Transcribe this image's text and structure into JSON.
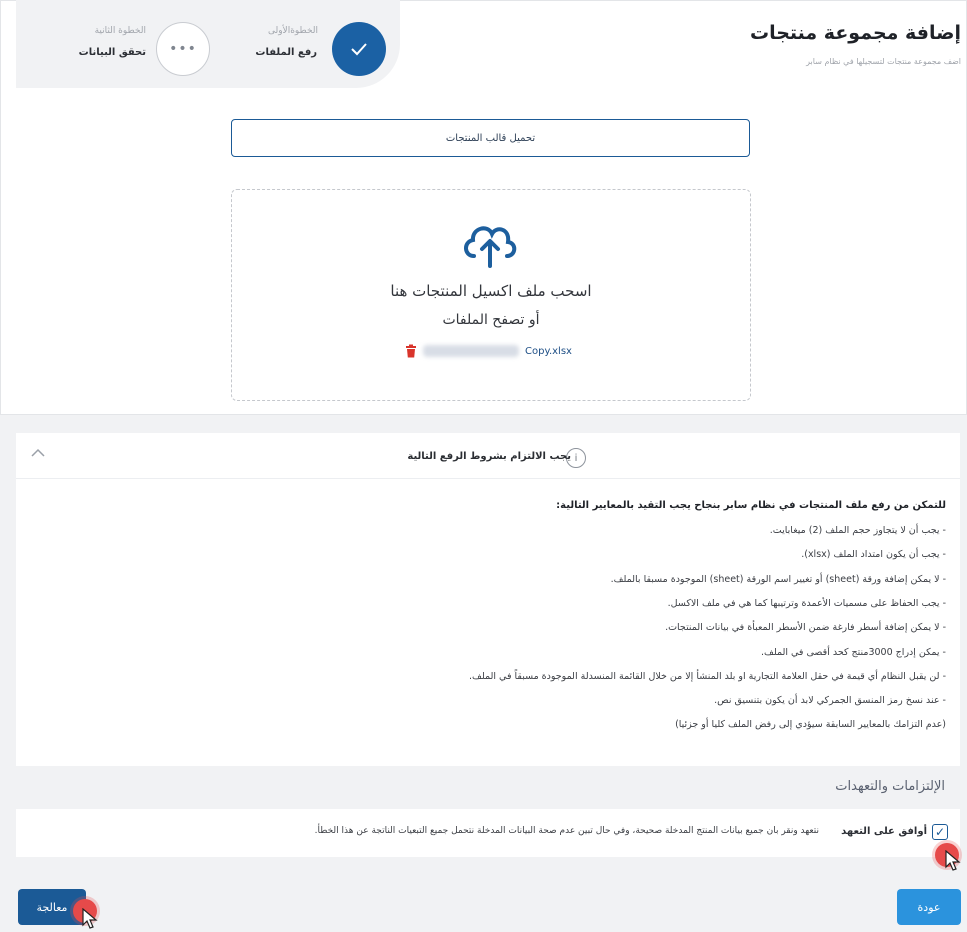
{
  "header": {
    "title": "إضافة مجموعة منتجات",
    "subtitle": "اضف مجموعة منتجات لتسجيلها في نظام سابر"
  },
  "stepper": {
    "step1": {
      "label": "الخطوةالأولى",
      "title": "رفع الملفات",
      "status": "done"
    },
    "step2": {
      "label": "الخطوة الثانية",
      "title": "تحقق البيانات",
      "status": "pending",
      "glyph": "•••"
    }
  },
  "upload": {
    "template_button": "تحميل قالب المنتجات",
    "drop_title": "اسحب ملف اكسيل المنتجات هنا",
    "browse": "أو تصفح الملفات",
    "file_name": "Copy.xlsx"
  },
  "rules": {
    "title": "يجب الالتزام بشروط الرفع التالية",
    "intro": "للتمكن من رفع ملف المنتجات في نظام سابر بنجاح يجب التقيد بالمعايير التالية:",
    "items": [
      "- يجب أن لا يتجاوز حجم الملف (2) ميغابايت.",
      "- يجب أن يكون امتداد الملف (xlsx).",
      "- لا يمكن إضافة ورقة (sheet) أو تغيير اسم الورقة (sheet) الموجودة مسبقا بالملف.",
      "- يجب الحفاظ على مسميات الأعمدة وترتيبها كما هي في ملف الاكسل.",
      "- لا يمكن إضافة أسطر فارغة ضمن الأسطر المعبأة في بيانات المنتجات.",
      "- يمكن إدراج 3000منتج كحد أقصى في الملف.",
      "- لن يقبل النظام أي قيمة في حقل العلامة التجارية او بلد المنشأ إلا من خلال القائمة المنسدلة الموجودة مسبقاً في الملف.",
      "- عند نسخ رمز المنسق الجمركي لابد أن يكون بتنسيق نص.",
      "(عدم التزامك بالمعايير السابقة سيؤدي إلى رفض الملف كليا أو جزئيا)"
    ]
  },
  "commitments": {
    "heading": "الإلتزامات والتعهدات",
    "agree_label": "أوافق على التعهد",
    "text": "نتعهد ونقر بان جميع بيانات المنتج المدخلة صحيحة، وفي حال تبين عدم صحة البيانات المدخلة نتحمل جميع التبعيات الناتجة عن هذا الخطأ.",
    "checked": true
  },
  "actions": {
    "back": "عودة",
    "process": "معالجة"
  },
  "colors": {
    "primary": "#1b5a96",
    "step_active": "#1b61a4",
    "back_button": "#2b93dd",
    "click_marker": "#e64a4a"
  }
}
